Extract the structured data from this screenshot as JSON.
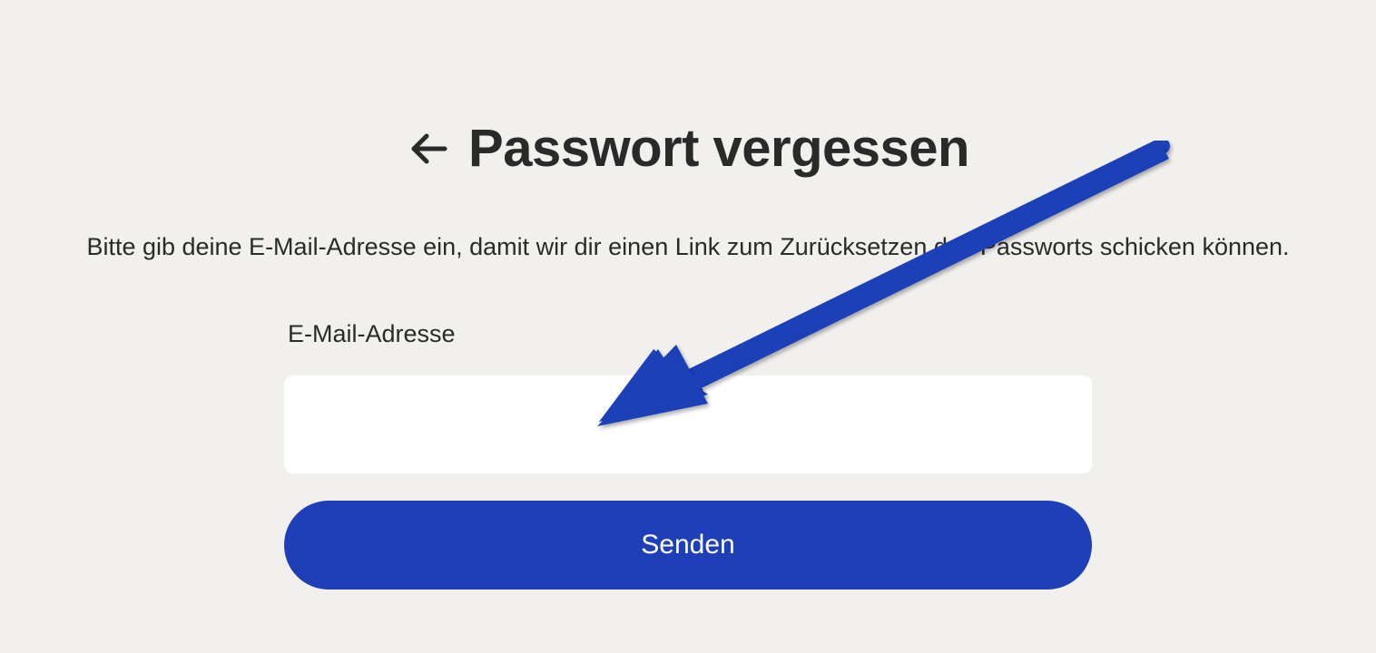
{
  "page": {
    "title": "Passwort vergessen",
    "description": "Bitte gib deine E-Mail-Adresse ein, damit wir dir einen Link zum Zurücksetzen des Passworts schicken können."
  },
  "form": {
    "email_label": "E-Mail-Adresse",
    "email_value": "",
    "submit_label": "Senden"
  },
  "colors": {
    "background": "#f2f0ed",
    "text": "#2a2a2a",
    "button_primary": "#1e3fb8",
    "input_bg": "#ffffff",
    "annotation_arrow": "#1e3fb8"
  }
}
